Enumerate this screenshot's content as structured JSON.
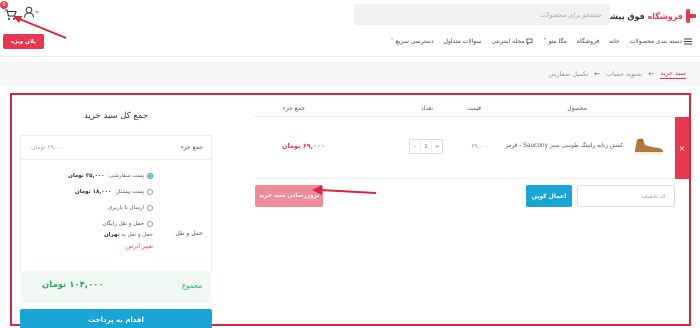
{
  "header": {
    "logo_brand": "فروشگاه",
    "logo_rest": "فوق پیشرفته",
    "search_placeholder": "جستجو برای محصولات",
    "cart_count": "0",
    "special_button": "پلان ویژه"
  },
  "nav": {
    "items": [
      {
        "label": "دسته بندی محصولات",
        "icon": "menu-icon"
      },
      {
        "label": "خانه"
      },
      {
        "label": "فروشگاه"
      },
      {
        "label": "مگا منو"
      },
      {
        "label": "مجله اینترنتی",
        "icon": "chat-icon"
      },
      {
        "label": "سوالات متداول"
      },
      {
        "label": "دسترسی سریع"
      }
    ]
  },
  "breadcrumb": {
    "step1": "سبد خرید",
    "step2": "تسویه حساب",
    "step3": "تکمیل سفارش"
  },
  "cart": {
    "headers": {
      "product": "محصول",
      "price": "قیمت",
      "qty": "تعداد",
      "total": "جمع جزء"
    },
    "rows": [
      {
        "name": "کفش زنانه رانینگ طوسی سبز Saucony - قرمز",
        "price": "۶۹,۰۰۰",
        "qty": "1",
        "total": "۶۹,۰۰۰ تومان"
      }
    ],
    "coupon_placeholder": "کد تخفیف",
    "coupon_button": "اعمال کوپن",
    "update_button": "بروزرسانی سبد خرید"
  },
  "totals": {
    "title": "جمع کل سبد خرید",
    "subtotal_label": "جمع جزء",
    "subtotal_value": "۶۹,۰۰۰ تومان",
    "shipping_label": "حمل و نقل",
    "options": [
      {
        "name": "پست سفارشی:",
        "price": "۳۵,۰۰۰ تومان",
        "selected": true
      },
      {
        "name": "پست پیشتاز:",
        "price": "۱۸,۰۰۰ تومان",
        "selected": false
      },
      {
        "name": "ارسال با باربری",
        "price": "",
        "selected": false
      },
      {
        "name": "حمل و نقل رایگان",
        "price": "",
        "selected": false
      }
    ],
    "ship_to_prefix": "حمل و نقل به",
    "ship_to_city": "تهران",
    "change_address": "تغییر آدرس",
    "total_label": "مجموع",
    "total_value": "۱۰۴,۰۰۰ تومان",
    "checkout_button": "اقدام به پرداخت"
  },
  "colors": {
    "accent": "#e8384f",
    "primary": "#19a5d6",
    "success": "#27ae60"
  }
}
